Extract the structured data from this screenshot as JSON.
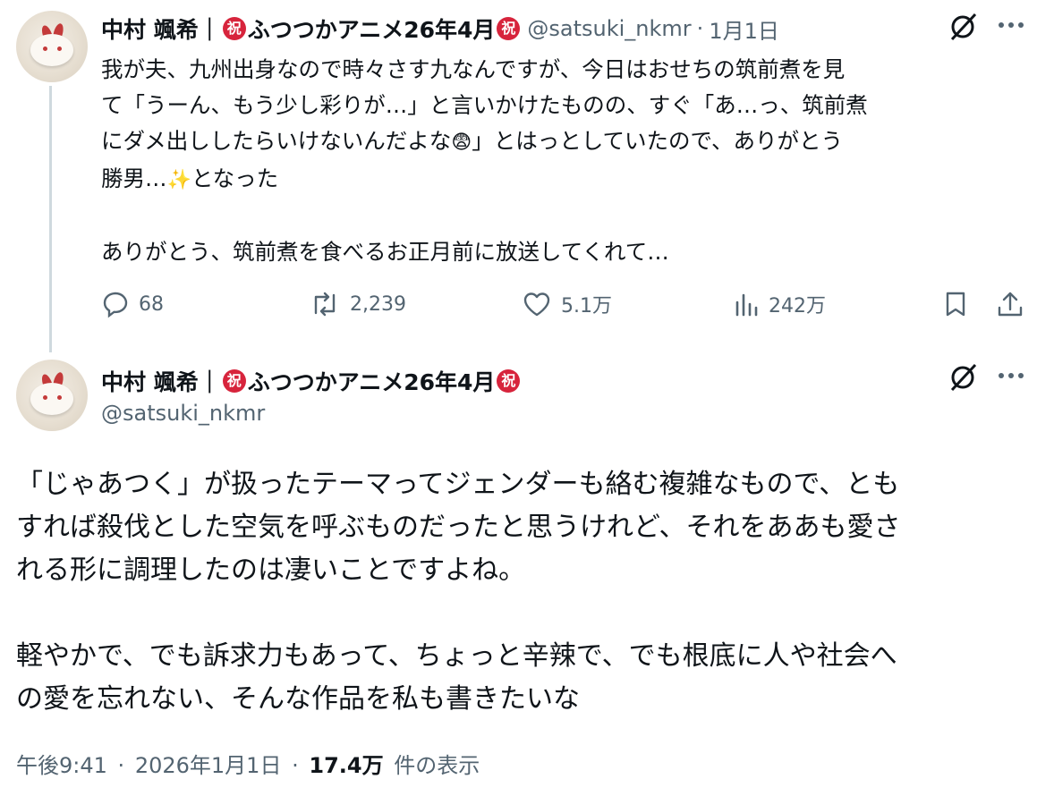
{
  "tweet1": {
    "display_name": "中村 颯希｜",
    "badge": "祝",
    "title_text": "ふつつかアニメ26年4月",
    "handle": "@satsuki_nkmr",
    "separator": "·",
    "date": "1月1日",
    "lines": [
      "我が夫、九州出身なので時々さす九なんですが、今日はおせちの筑前煮を見",
      "て「うーん、もう少し彩りが…」と言いかけたものの、すぐ「あ…っ、筑前煮",
      "にダメ出ししたらいけないんだよな",
      "」とはっとしていたので、ありがとう",
      "勝男…",
      "となった",
      "ありがとう、筑前煮を食べるお正月前に放送してくれて…"
    ],
    "emoji_anxious": "😨",
    "emoji_sparkles": "✨",
    "stats": {
      "replies": "68",
      "reposts": "2,239",
      "likes": "5.1万",
      "views": "242万"
    }
  },
  "tweet2": {
    "display_name": "中村 颯希｜",
    "badge": "祝",
    "title_text": "ふつつかアニメ26年4月",
    "handle": "@satsuki_nkmr",
    "lines": [
      "「じゃあつく」が扱ったテーマってジェンダーも絡む複雑なもので、とも",
      "すれば殺伐とした空気を呼ぶものだったと思うけれど、それをああも愛さ",
      "れる形に調理したのは凄いことですよね。",
      "軽やかで、でも訴求力もあって、ちょっと辛辣で、でも根底に人や社会へ",
      "の愛を忘れない、そんな作品を私も書きたいな"
    ],
    "meta": {
      "time": "午後9:41",
      "separator": "·",
      "date": "2026年1月1日",
      "views_count": "17.4万",
      "views_label": "件の表示"
    }
  },
  "colors": {
    "text": "#0f1419",
    "secondary": "#536471",
    "badge": "#d7243c",
    "thread_line": "#cfd9de"
  },
  "icons": [
    "grok-icon",
    "more-icon",
    "reply-icon",
    "repost-icon",
    "like-icon",
    "views-icon",
    "bookmark-icon",
    "share-icon"
  ]
}
